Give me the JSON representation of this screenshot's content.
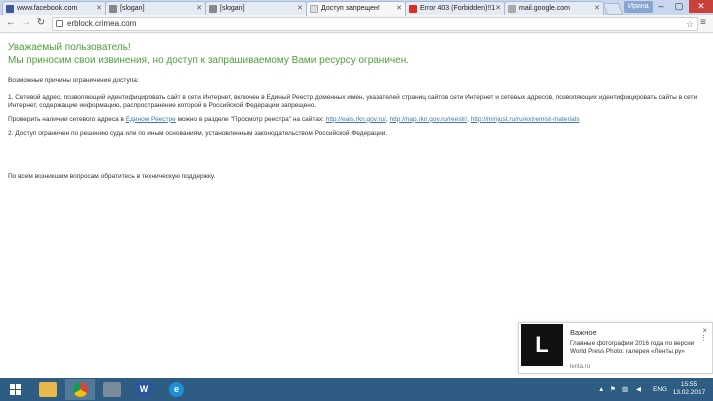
{
  "tabs": [
    {
      "title": "www.facebook.com",
      "favicon_color": "#3b5998"
    },
    {
      "title": "[slogan]",
      "favicon_color": "#888888"
    },
    {
      "title": "[slogan]",
      "favicon_color": "#888888"
    },
    {
      "title": "Доступ запрещен!",
      "favicon_color": "#dddddd"
    },
    {
      "title": "Error 403 (Forbidden)!!1",
      "favicon_color": "#d93025"
    },
    {
      "title": "mail.google.com",
      "favicon_color": "#aaaaaa"
    }
  ],
  "window": {
    "user_name": "Ирина",
    "minimize": "–",
    "maximize": "▢",
    "close": "✕"
  },
  "toolbar": {
    "back": "←",
    "forward": "→",
    "reload": "↻",
    "url": "erblock.crimea.com",
    "star": "☆",
    "menu": "≡"
  },
  "page": {
    "heading_line1": "Уважаемый пользователь!",
    "heading_line2": "Мы приносим свои извинения, но доступ к запрашиваемому Вами ресурсу ограничен.",
    "reasons_label": "Возможные причины ограничения доступа:",
    "reason1": "1. Сетевой адрес, позволяющий идентифицировать сайт в сети Интернет, включен в Единый Реестр доменных имен, указателей страниц сайтов сети Интернет и сетевых адресов, позволяющих идентифицировать сайты в сети Интернет, содержащие информацию, распространение которой в Российской Федерации запрещено.",
    "check_prefix": "Проверить наличии сетевого адреса в ",
    "registry_link": "Едином Реестре",
    "check_middle": " можно в разделе \"Просмотр реестра\" на сайтах: ",
    "link1": "http://eais.rkn.gov.ru/",
    "sep1": ", ",
    "link2": "http://nap.rkn.gov.ru/reestr/",
    "sep2": ", ",
    "link3": "http://minjust.ru/ru/extremist-materials",
    "reason2": "2. Доступ ограничен по решению суда или по иным основаниям, установленным законодательством Российской Федерации.",
    "support": "По всем возникшим вопросам обратитесь в техническую поддержку."
  },
  "notification": {
    "logo_letter": "L",
    "title": "Важное",
    "body": "Главные фотографии 2016 года по версии World Press Photo: галерея «Ленты.ру»",
    "source": "lenta.ru",
    "close": "×",
    "more": "⋮"
  },
  "taskbar": {
    "apps": [
      {
        "name": "file-explorer",
        "color": "#e8b84a"
      },
      {
        "name": "chrome",
        "color": "#db4437"
      },
      {
        "name": "files",
        "color": "#7a8a99"
      },
      {
        "name": "word",
        "color": "#2b579a"
      },
      {
        "name": "internet-explorer",
        "color": "#1e90d6"
      }
    ],
    "language": "ENG",
    "time": "15:55",
    "date": "13.02.2017"
  }
}
